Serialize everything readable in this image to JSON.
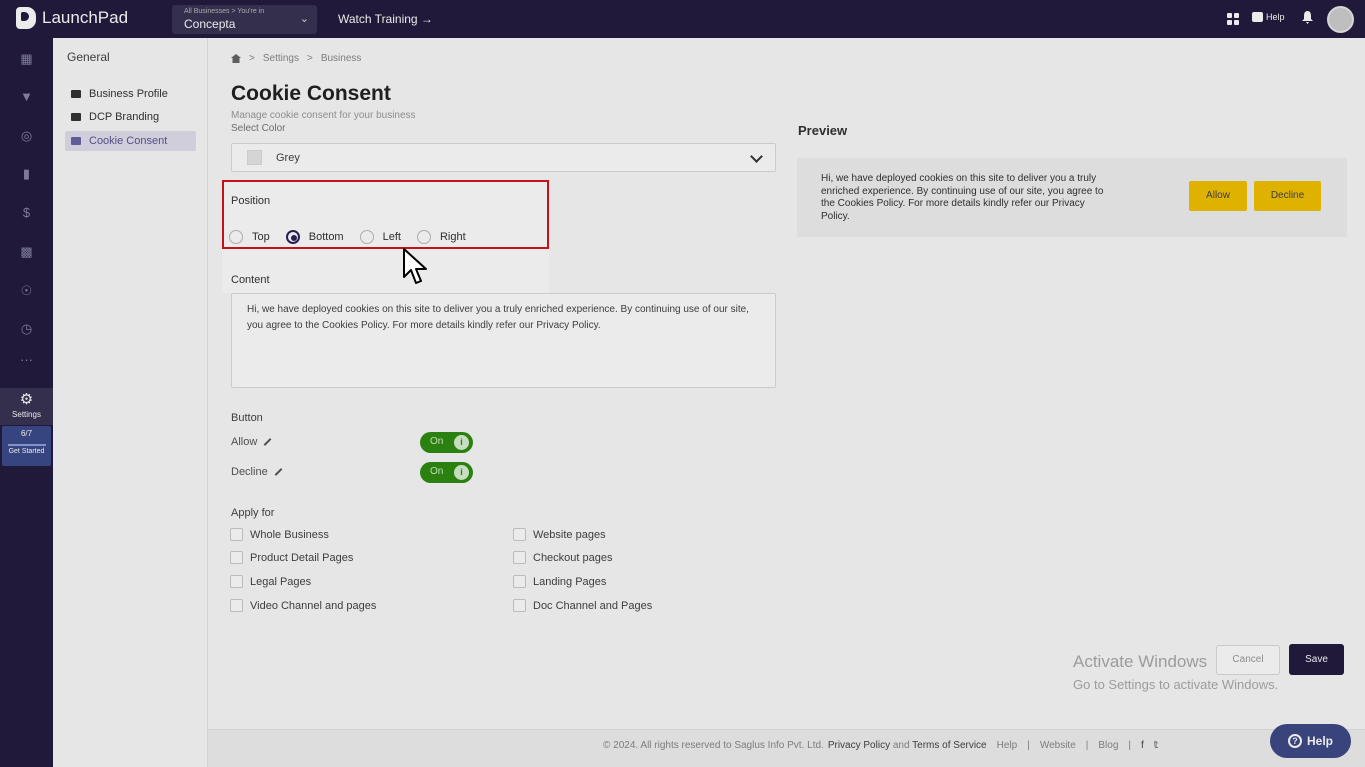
{
  "topbar": {
    "app_name": "LaunchPad",
    "business_sub": "All Businesses > You're in",
    "business_name": "Concepta",
    "watch_training": "Watch Training →",
    "help": "Help"
  },
  "rail": {
    "settings_label": "Settings",
    "progress_count": "6/7",
    "progress_fraction": 0.857,
    "get_started": "Get Started",
    "icons": [
      "dashboard-icon",
      "funnel-icon",
      "globe-icon",
      "video-icon",
      "dollar-icon",
      "chart-icon",
      "users-icon",
      "clock-icon",
      "more-icon"
    ]
  },
  "subnav": {
    "title": "General",
    "items": [
      {
        "label": "Business Profile",
        "icon": "id-card-icon"
      },
      {
        "label": "DCP Branding",
        "icon": "brand-icon"
      },
      {
        "label": "Cookie Consent",
        "icon": "cookie-icon",
        "active": true
      }
    ]
  },
  "breadcrumb": {
    "settings": "Settings",
    "business": "Business",
    "sep": ">"
  },
  "page": {
    "title": "Cookie Consent",
    "subtitle": "Manage cookie consent for your business",
    "select_color_label": "Select Color",
    "color_value": "Grey",
    "position_label": "Position",
    "positions": [
      "Top",
      "Bottom",
      "Left",
      "Right"
    ],
    "selected_position": "Bottom",
    "content_label": "Content",
    "content_text": "Hi, we have deployed cookies on this site to deliver you a truly enriched experience. By continuing use of our site, you agree to the Cookies Policy. For more details kindly refer our Privacy Policy.",
    "button_label": "Button",
    "allow_label": "Allow",
    "decline_label": "Decline",
    "toggle_on": "On",
    "apply_for_label": "Apply for",
    "apply_left": [
      "Whole Business",
      "Product Detail Pages",
      "Legal Pages",
      "Video Channel and pages"
    ],
    "apply_right": [
      "Website pages",
      "Checkout pages",
      "Landing Pages",
      "Doc Channel and Pages"
    ],
    "cancel": "Cancel",
    "save": "Save"
  },
  "preview": {
    "title": "Preview",
    "text": "Hi, we have deployed cookies on this site to deliver you a truly enriched experience. By continuing use of our site, you agree to the Cookies Policy. For more details kindly refer our Privacy Policy.",
    "allow": "Allow",
    "decline": "Decline"
  },
  "watermark": {
    "line1": "Activate Windows",
    "line2": "Go to Settings to activate Windows."
  },
  "footer": {
    "copyright": "© 2024. All rights reserved to Saglus Info Pvt. Ltd.",
    "privacy": "Privacy Policy",
    "and": "and",
    "terms": "Terms of Service",
    "links": [
      "Help",
      "Website",
      "Blog"
    ],
    "divider": "|"
  },
  "help_fab": "Help",
  "colors": {
    "brand": "#231c3f",
    "accent_yellow": "#f2c200",
    "toggle_green": "#2f8c12",
    "highlight_red": "#d9121c"
  }
}
